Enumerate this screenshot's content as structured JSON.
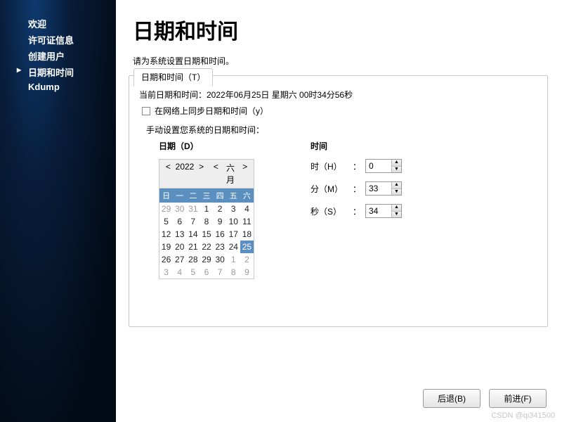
{
  "sidebar": {
    "items": [
      {
        "label": "欢迎"
      },
      {
        "label": "许可证信息"
      },
      {
        "label": "创建用户"
      },
      {
        "label": "日期和时间"
      },
      {
        "label": "Kdump"
      }
    ],
    "current_index": 3
  },
  "page": {
    "title": "日期和时间",
    "subtitle": "请为系统设置日期和时间。"
  },
  "tab": {
    "label": "日期和时间（T）"
  },
  "datetime": {
    "current_label": "当前日期和时间：2022年06月25日  星期六  00时34分56秒",
    "sync_checkbox_label": "在网络上同步日期和时间（y）",
    "sync_checked": false,
    "manual_label": "手动设置您系统的日期和时间：",
    "date_heading": "日期（D）",
    "time_heading": "时间",
    "time_fields": {
      "hour_label": "时（H）",
      "minute_label": "分（M）",
      "second_label": "秒（S）",
      "hour": "0",
      "minute": "33",
      "second": "34"
    },
    "calendar": {
      "year_label": "2022",
      "month_label": "六月",
      "weekdays": [
        "日",
        "一",
        "二",
        "三",
        "四",
        "五",
        "六"
      ],
      "cells": [
        {
          "d": "29",
          "g": true
        },
        {
          "d": "30",
          "g": true
        },
        {
          "d": "31",
          "g": true
        },
        {
          "d": "1"
        },
        {
          "d": "2"
        },
        {
          "d": "3"
        },
        {
          "d": "4"
        },
        {
          "d": "5"
        },
        {
          "d": "6"
        },
        {
          "d": "7"
        },
        {
          "d": "8"
        },
        {
          "d": "9"
        },
        {
          "d": "10"
        },
        {
          "d": "11"
        },
        {
          "d": "12"
        },
        {
          "d": "13"
        },
        {
          "d": "14"
        },
        {
          "d": "15"
        },
        {
          "d": "16"
        },
        {
          "d": "17"
        },
        {
          "d": "18"
        },
        {
          "d": "19"
        },
        {
          "d": "20"
        },
        {
          "d": "21"
        },
        {
          "d": "22"
        },
        {
          "d": "23"
        },
        {
          "d": "24"
        },
        {
          "d": "25",
          "sel": true
        },
        {
          "d": "26"
        },
        {
          "d": "27"
        },
        {
          "d": "28"
        },
        {
          "d": "29"
        },
        {
          "d": "30"
        },
        {
          "d": "1",
          "g": true
        },
        {
          "d": "2",
          "g": true
        },
        {
          "d": "3",
          "g": true
        },
        {
          "d": "4",
          "g": true
        },
        {
          "d": "5",
          "g": true
        },
        {
          "d": "6",
          "g": true
        },
        {
          "d": "7",
          "g": true
        },
        {
          "d": "8",
          "g": true
        },
        {
          "d": "9",
          "g": true
        }
      ]
    }
  },
  "footer": {
    "back_label": "后退(B)",
    "forward_label": "前进(F)"
  },
  "watermark": "CSDN @qi341500"
}
